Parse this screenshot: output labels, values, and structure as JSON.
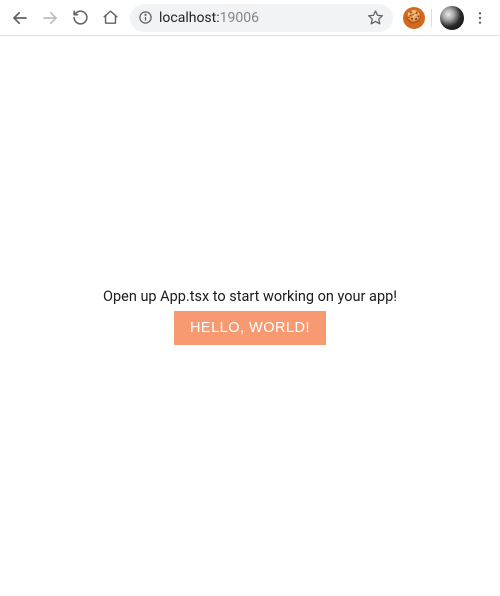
{
  "toolbar": {
    "url_host": "localhost:",
    "url_port": "19006"
  },
  "content": {
    "message": "Open up App.tsx to start working on your app!",
    "button_label": "HELLO, WORLD!"
  }
}
